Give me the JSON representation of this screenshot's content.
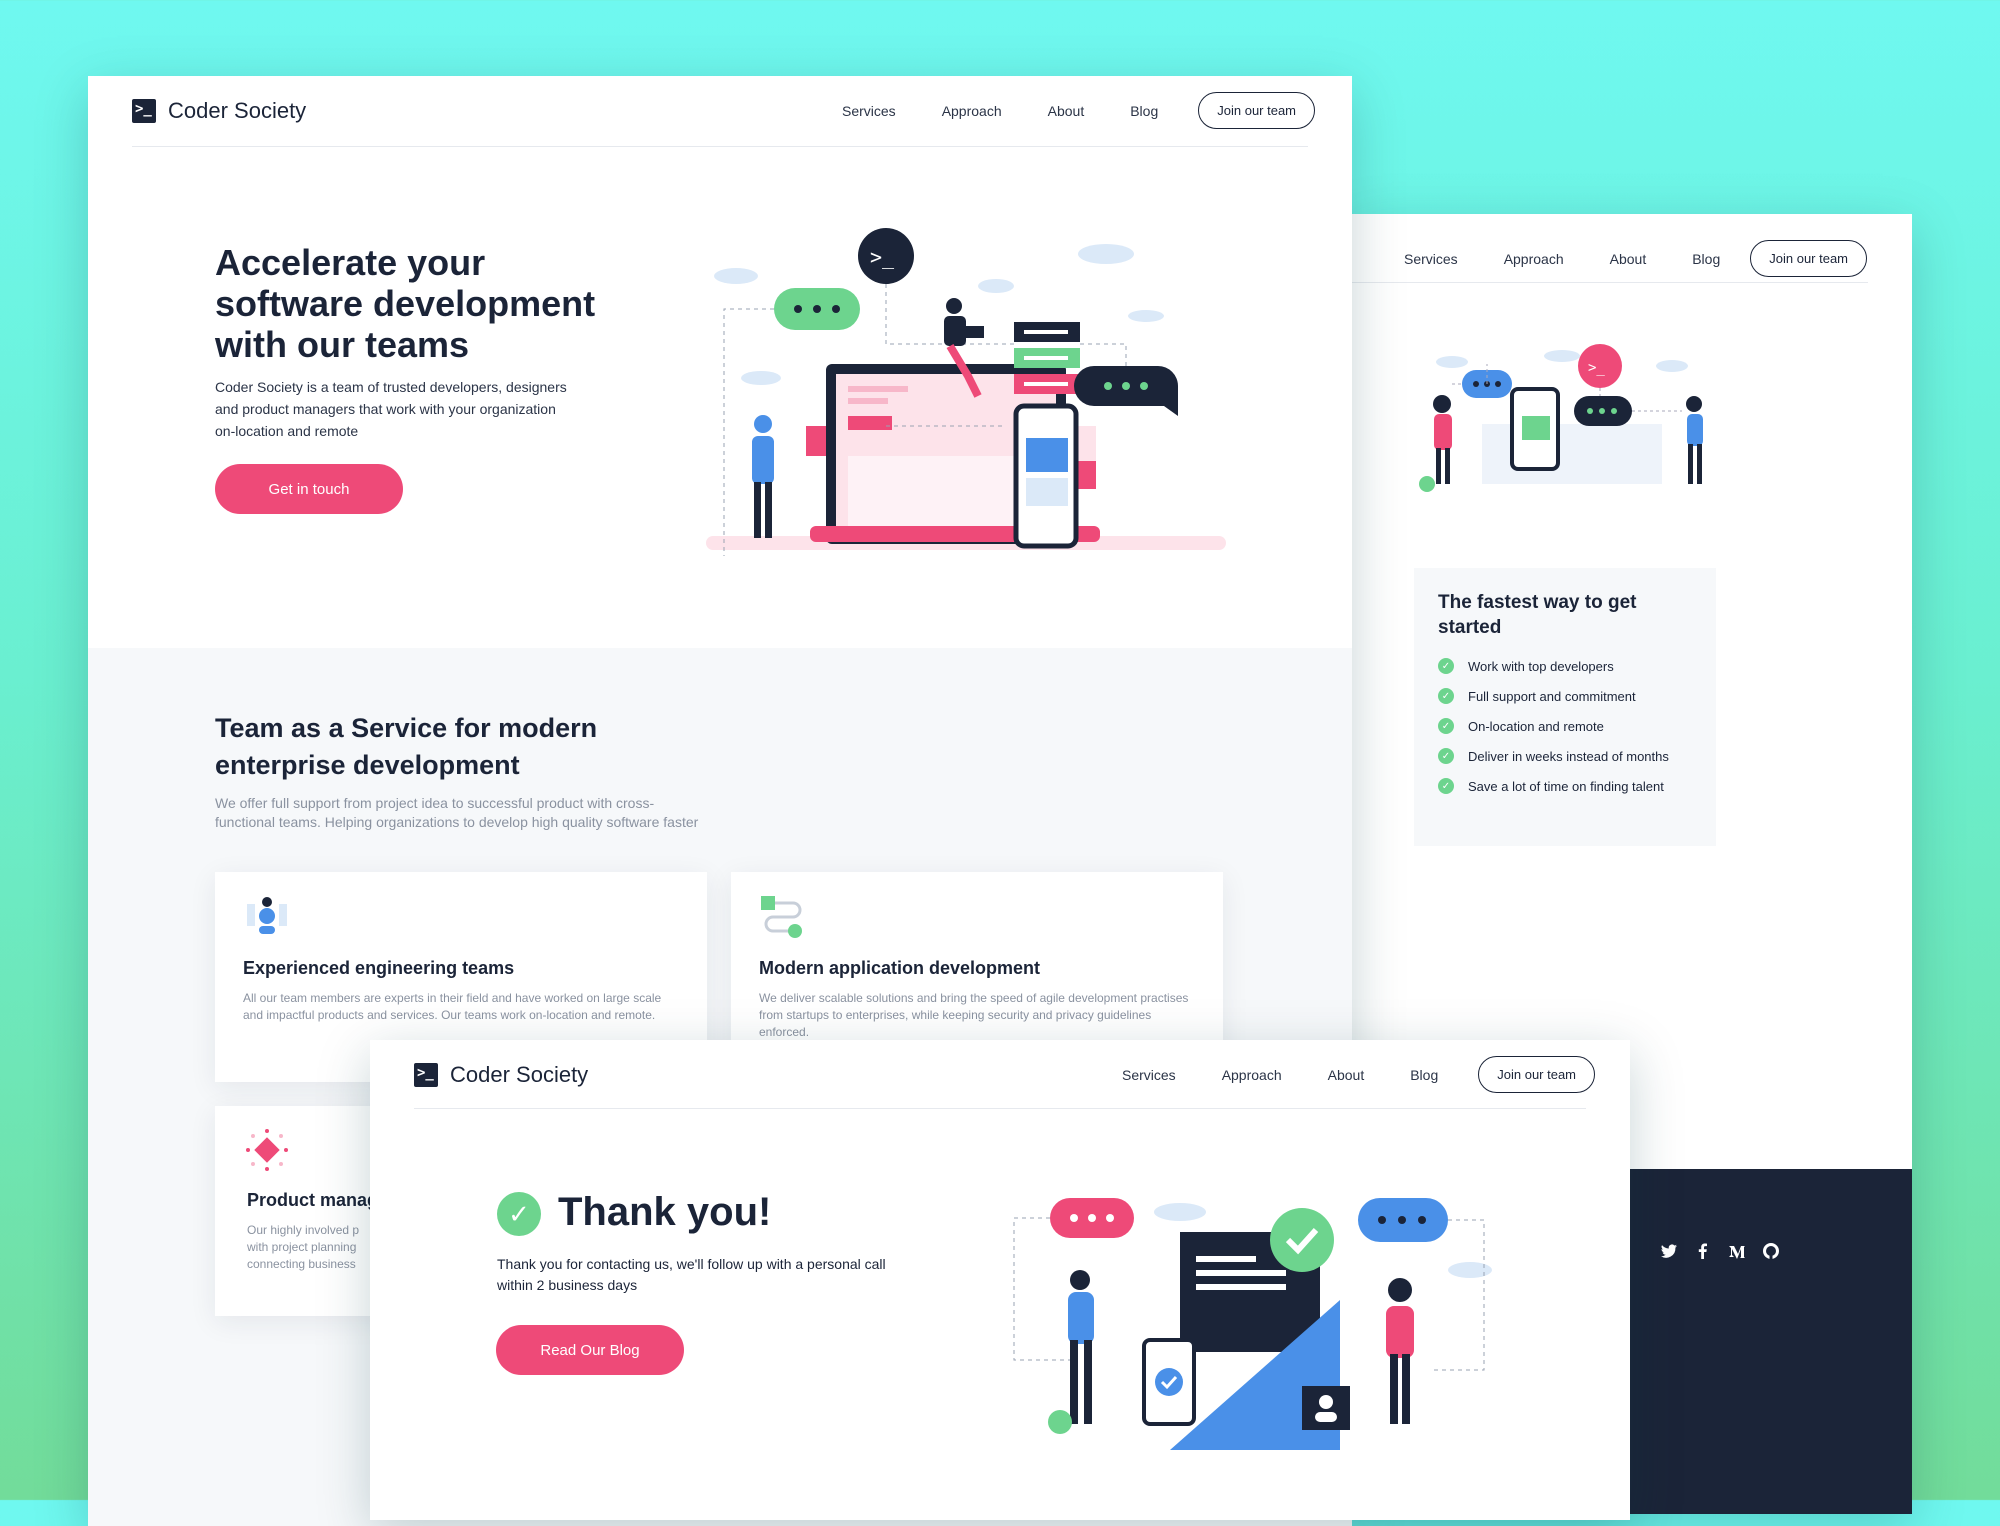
{
  "brand": {
    "name": "Coder Society",
    "logo_glyph": ">_"
  },
  "nav": {
    "services": "Services",
    "approach": "Approach",
    "about": "About",
    "blog": "Blog",
    "join": "Join our team"
  },
  "home": {
    "hero_title_1": "Accelerate your",
    "hero_title_2": "software development",
    "hero_title_3": "with our teams",
    "hero_text_1": "Coder Society is a team of trusted developers, designers",
    "hero_text_2": "and product managers that work with your organization",
    "hero_text_3": "on-location and remote",
    "cta": "Get in touch",
    "section_title_1": "Team as a Service for modern",
    "section_title_2": "enterprise development",
    "section_text_1": "We offer full support from project idea to successful product with cross-",
    "section_text_2": "functional teams. Helping organizations to develop high quality software faster",
    "features": [
      {
        "title": "Experienced engineering teams",
        "text": "All our team members are experts in their field and have worked on large scale and impactful products and services. Our teams work on-location and remote."
      },
      {
        "title": "Modern application development",
        "text": "We deliver scalable solutions and bring the speed of agile development practises from startups to enterprises, while keeping security and privacy guidelines enforced."
      },
      {
        "title": "Product manag",
        "text_1": "Our highly involved p",
        "text_2": "with project planning",
        "text_3": "connecting business"
      }
    ]
  },
  "join_page": {
    "box_title_1": "The fastest way to get",
    "box_title_2": "started",
    "benefits": [
      "Work with top developers",
      "Full support and commitment",
      "On-location and remote",
      "Deliver in weeks instead of months",
      "Save a lot of time on finding talent"
    ]
  },
  "thanks": {
    "title": "Thank you!",
    "text_1": "Thank you for contacting us, we'll follow up with a personal call",
    "text_2": "within 2 business days",
    "cta": "Read Our Blog"
  },
  "social": [
    "twitter-icon",
    "facebook-icon",
    "medium-icon",
    "github-icon"
  ],
  "colors": {
    "navy": "#1b2438",
    "pink": "#ee4a78",
    "green": "#6dd48e",
    "blue": "#4a90e8",
    "bg_teal": "#6ff8f0"
  }
}
